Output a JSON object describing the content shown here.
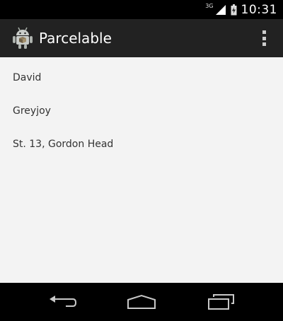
{
  "status_bar": {
    "network_type": "3G",
    "time": "10:31"
  },
  "action_bar": {
    "title": "Parcelable",
    "app_icon": "android-robot-icon",
    "overflow_icon": "overflow-menu-icon"
  },
  "content": {
    "first_name": "David",
    "last_name": "Greyjoy",
    "address": "St. 13, Gordon Head"
  },
  "navigation": {
    "back_icon": "back-icon",
    "home_icon": "home-icon",
    "recents_icon": "recents-icon"
  }
}
